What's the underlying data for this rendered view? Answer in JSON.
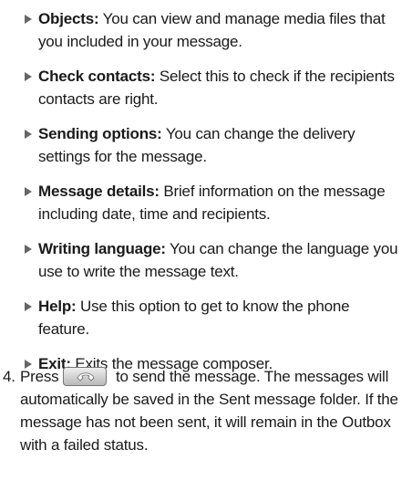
{
  "options": [
    {
      "term": "Objects:",
      "description": " You can view and manage media files that you included in your message."
    },
    {
      "term": "Check contacts:",
      "description": " Select this to check if the recipients contacts are right."
    },
    {
      "term": "Sending options:",
      "description": " You can change the delivery settings for the message."
    },
    {
      "term": "Message details:",
      "description": " Brief information on the message including date, time and recipients."
    },
    {
      "term": "Writing language:",
      "description": " You can change the language you use to write the message text."
    },
    {
      "term": "Help:",
      "description": " Use this option to get to know the phone feature."
    },
    {
      "term": "Exit:",
      "description": " Exits the message composer."
    }
  ],
  "step": {
    "number": "4.",
    "before_key": "Press",
    "key_icon": "send-key-icon",
    "after_key": " to send the message. The messages will automatically be saved in the Sent message folder. If the message has not been sent, it will remain in the Outbox with a failed status."
  }
}
